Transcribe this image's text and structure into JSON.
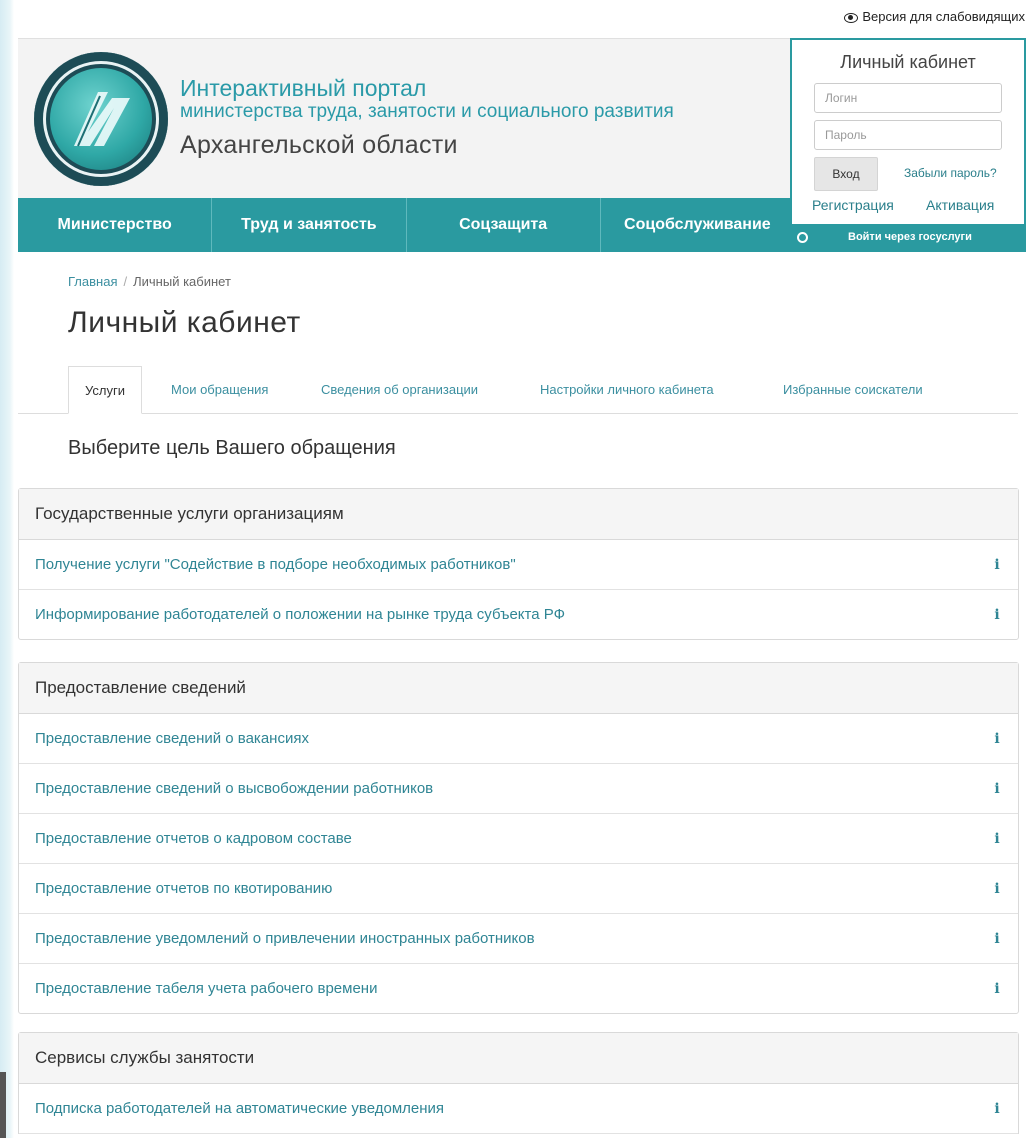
{
  "accessibility": {
    "label": "Версия для слабовидящих",
    "icon": "eye-icon"
  },
  "header": {
    "title_line1": "Интерактивный портал",
    "title_line2": "министерства труда, занятости и социального развития",
    "title_line3": "Архангельской области",
    "accent_color": "#2a9aa0"
  },
  "nav": {
    "items": [
      "Министерство",
      "Труд и занятость",
      "Соцзащита",
      "Соцобслуживание"
    ]
  },
  "login_box": {
    "title": "Личный кабинет",
    "login_placeholder": "Логин",
    "password_placeholder": "Пароль",
    "enter_label": "Вход",
    "forgot_label": "Забыли пароль?",
    "register_label": "Регистрация",
    "activate_label": "Активация",
    "gosuslugi_label": "Войти через госуслуги"
  },
  "breadcrumb": {
    "home": "Главная",
    "separator": "/",
    "current": "Личный кабинет"
  },
  "page_title": "Личный кабинет",
  "tabs": [
    "Услуги",
    "Мои обращения",
    "Сведения об организации",
    "Настройки личного кабинета",
    "Избранные соискатели"
  ],
  "prompt": "Выберите цель Вашего обращения",
  "panels": [
    {
      "title": "Государственные услуги организациям",
      "items": [
        "Получение услуги \"Содействие в подборе необходимых работников\"",
        "Информирование работодателей о положении на рынке труда субъекта РФ"
      ]
    },
    {
      "title": "Предоставление сведений",
      "items": [
        "Предоставление сведений о вакансиях",
        "Предоставление сведений о высвобождении работников",
        "Предоставление отчетов о кадровом составе",
        "Предоставление отчетов по квотированию",
        "Предоставление уведомлений о привлечении иностранных работников",
        "Предоставление табеля учета рабочего времени"
      ]
    },
    {
      "title": "Сервисы службы занятости",
      "items": [
        "Подписка работодателей на автоматические уведомления"
      ]
    }
  ],
  "info_icon_glyph": "i"
}
